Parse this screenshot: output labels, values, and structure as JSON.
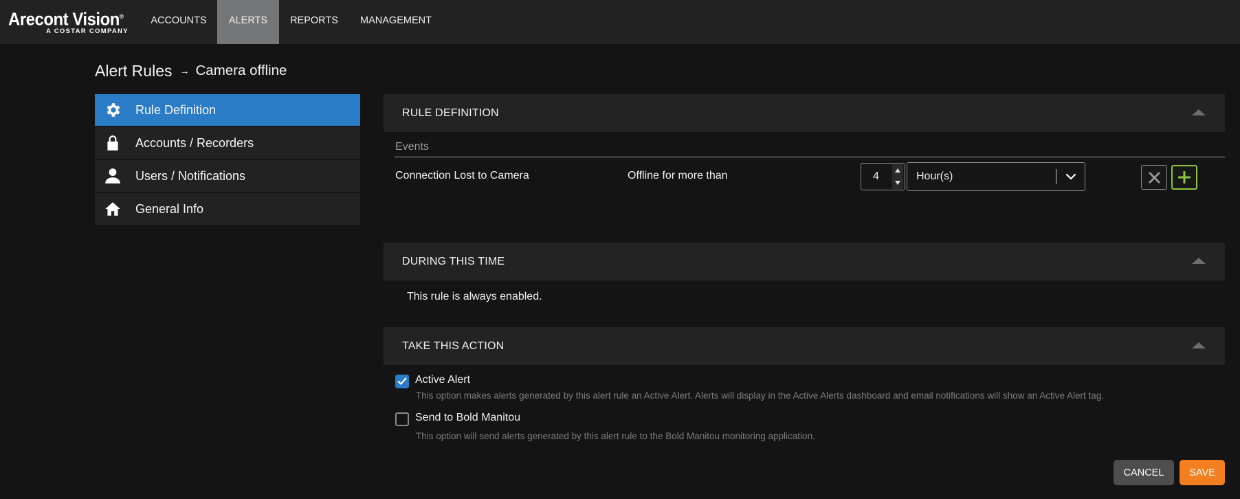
{
  "brand": {
    "name": "Arecont Vision",
    "mark": "®",
    "tagline": "A COSTAR COMPANY"
  },
  "nav": {
    "items": [
      {
        "label": "ACCOUNTS",
        "active": false
      },
      {
        "label": "ALERTS",
        "active": true
      },
      {
        "label": "REPORTS",
        "active": false
      },
      {
        "label": "MANAGEMENT",
        "active": false
      }
    ]
  },
  "breadcrumb": {
    "root": "Alert Rules",
    "separator": "→",
    "current": "Camera offline"
  },
  "sidebar": {
    "items": [
      {
        "label": "Rule Definition",
        "icon": "gear-icon",
        "active": true
      },
      {
        "label": "Accounts / Recorders",
        "icon": "lock-icon",
        "active": false
      },
      {
        "label": "Users / Notifications",
        "icon": "user-icon",
        "active": false
      },
      {
        "label": "General Info",
        "icon": "home-icon",
        "active": false
      }
    ]
  },
  "rule_definition": {
    "title": "RULE DEFINITION",
    "events_label": "Events",
    "event": {
      "name": "Connection Lost to Camera",
      "condition": "Offline for more than",
      "amount": "4",
      "unit": "Hour(s)"
    }
  },
  "during": {
    "title": "DURING THIS TIME",
    "text": "This rule is always enabled."
  },
  "action": {
    "title": "TAKE THIS ACTION",
    "options": [
      {
        "label": "Active Alert",
        "checked": true,
        "description": "This option makes alerts generated by this alert rule an Active Alert. Alerts will display in the Active Alerts dashboard and email notifications will show an Active Alert tag."
      },
      {
        "label": "Send to Bold Manitou",
        "checked": false,
        "description": "This option will send alerts generated by this alert rule to the Bold Manitou monitoring application."
      }
    ]
  },
  "footer": {
    "cancel_label": "CANCEL",
    "save_label": "SAVE"
  },
  "colors": {
    "background": "#141414",
    "topbar": "#222222",
    "nav_active": "#757678",
    "accent_blue": "#2a7cc7",
    "add_green": "#8cc63f",
    "save_orange": "#f47f20",
    "cancel_gray": "#4d4d4d"
  }
}
